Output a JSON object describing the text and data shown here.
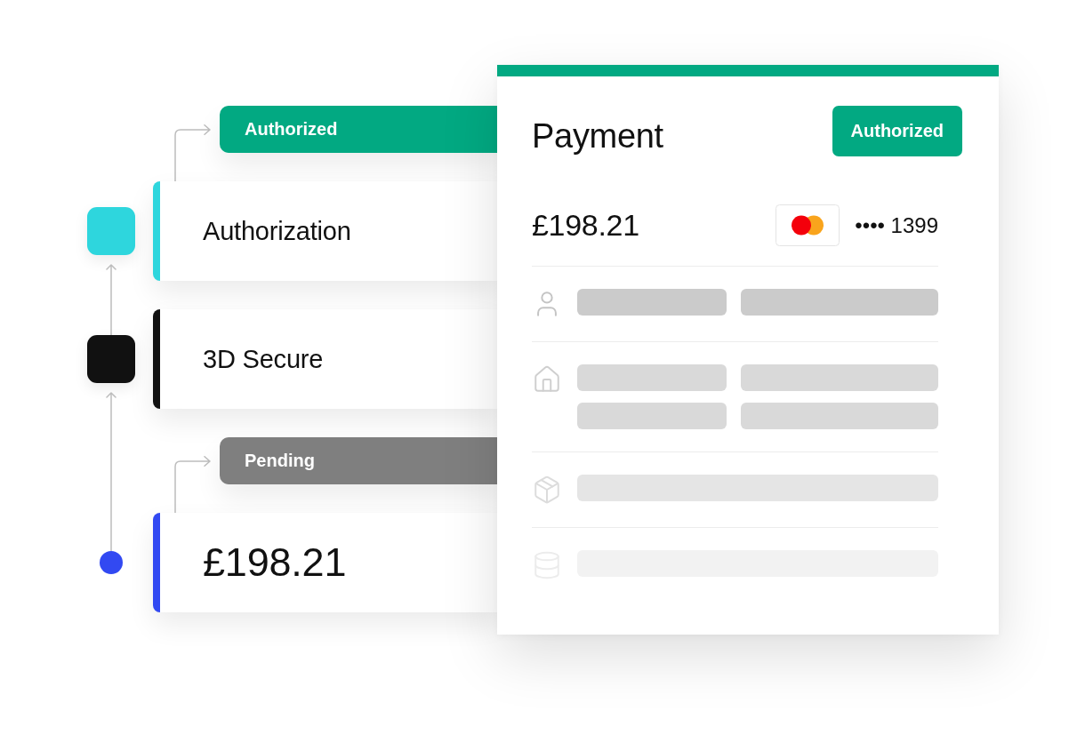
{
  "timeline": [
    {
      "kind": "step",
      "title": "Authorization",
      "color": "#2ed6dd",
      "status": {
        "label": "Authorized",
        "color": "#02a982"
      }
    },
    {
      "kind": "step",
      "title": "3D Secure",
      "color": "#111111"
    },
    {
      "kind": "amount",
      "title": "£198.21",
      "color": "#3249f2",
      "status": {
        "label": "Pending",
        "color": "#7f7f7f"
      }
    }
  ],
  "payment": {
    "title": "Payment",
    "status": {
      "label": "Authorized",
      "color": "#02a982"
    },
    "amount": "£198.21",
    "card_number": "•••• 1399"
  }
}
